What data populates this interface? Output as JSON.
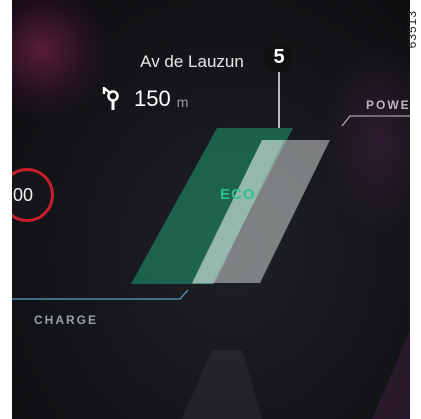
{
  "navigation": {
    "street_name": "Av de Lauzun",
    "distance_value": "150",
    "distance_unit": "m",
    "maneuver_icon": "roundabout-turn-icon"
  },
  "callout": {
    "number": "5"
  },
  "reference_code": "63513",
  "speed_limit": {
    "value": "00",
    "ring_color": "#c81e2a"
  },
  "power_gauge": {
    "power_label": "POWER",
    "eco_label": "ECO",
    "charge_label": "CHARGE",
    "eco_color": "#2cc28a",
    "charge_line_color": "#5aa0c8"
  },
  "status_icons": {
    "battery": "battery-icon"
  }
}
